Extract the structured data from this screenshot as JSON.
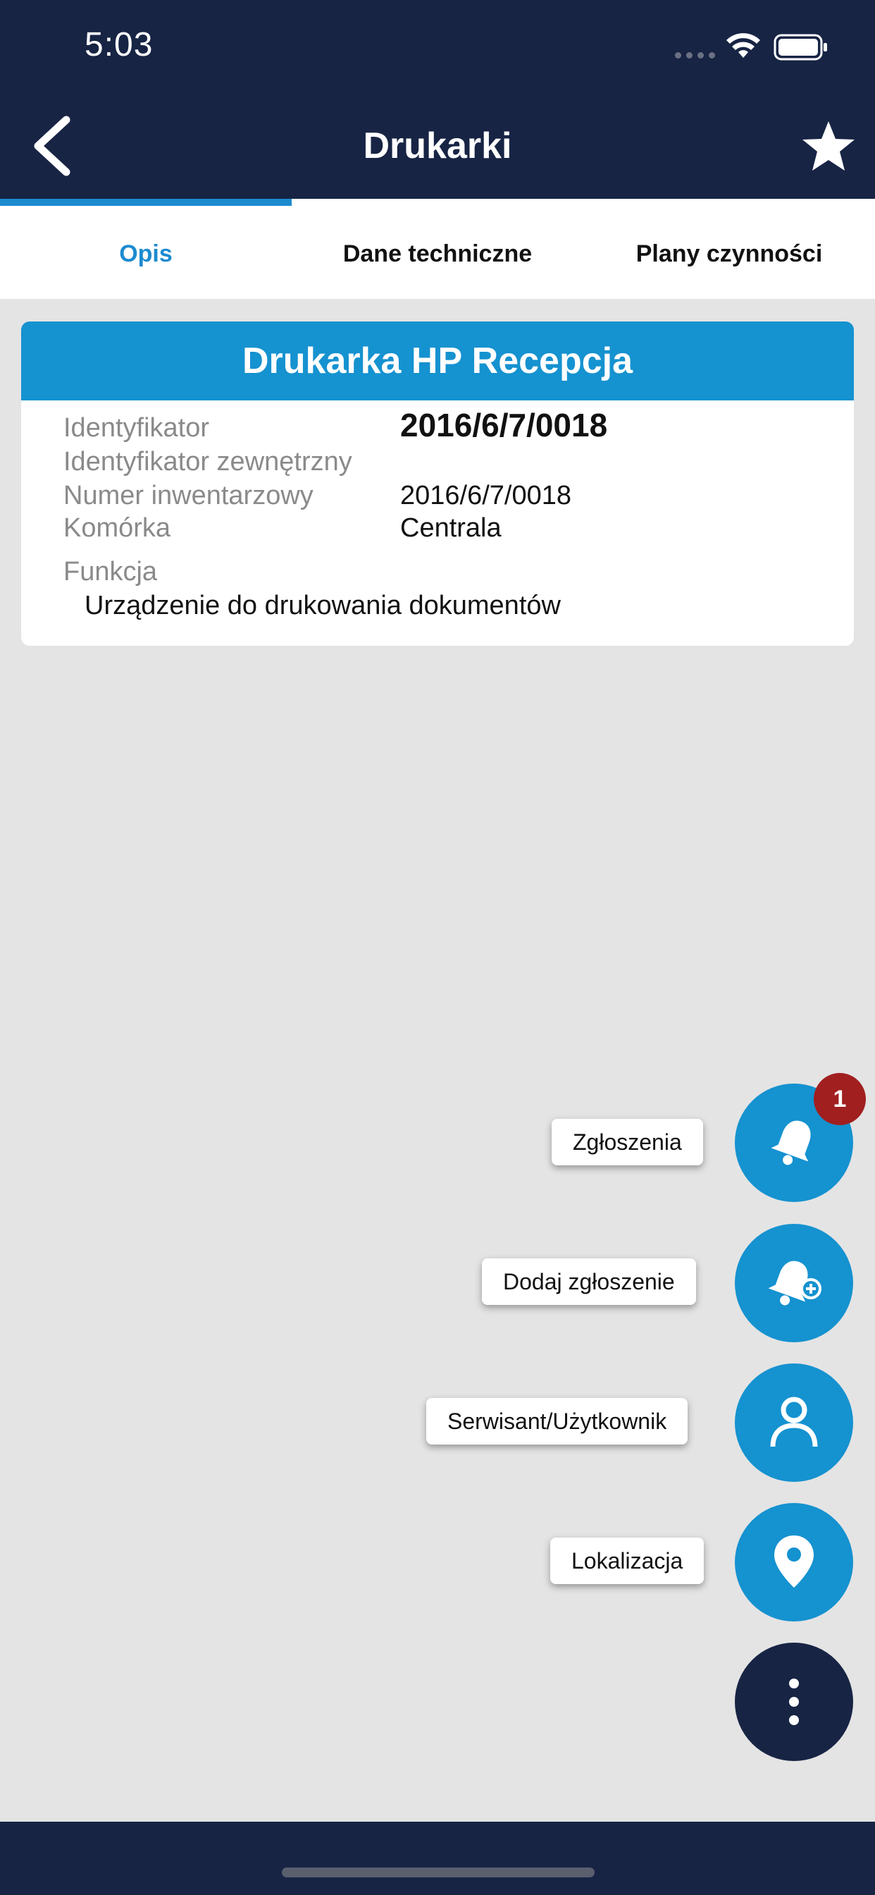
{
  "status_bar": {
    "time": "5:03"
  },
  "nav": {
    "title": "Drukarki",
    "back_icon": "chevron-left-icon",
    "favorite_icon": "star-icon"
  },
  "tabs": [
    {
      "label": "Opis",
      "active": true
    },
    {
      "label": "Dane techniczne",
      "active": false
    },
    {
      "label": "Plany czynności",
      "active": false
    }
  ],
  "card": {
    "title": "Drukarka HP Recepcja",
    "fields": [
      {
        "label": "Identyfikator",
        "value": "2016/6/7/0018"
      },
      {
        "label": "Identyfikator zewnętrzny",
        "value": ""
      },
      {
        "label": "Numer inwentarzowy",
        "value": "2016/6/7/0018"
      },
      {
        "label": "Komórka",
        "value": "Centrala"
      }
    ],
    "function_label": "Funkcja",
    "function_value": "Urządzenie do drukowania dokumentów"
  },
  "actions": [
    {
      "label": "Zgłoszenia",
      "icon": "bell-icon",
      "badge": "1"
    },
    {
      "label": "Dodaj zgłoszenie",
      "icon": "bell-plus-icon"
    },
    {
      "label": "Serwisant/Użytkownik",
      "icon": "user-icon"
    },
    {
      "label": "Lokalizacja",
      "icon": "location-pin-icon"
    }
  ],
  "menu_fab": {
    "icon": "more-vertical-icon"
  },
  "colors": {
    "header": "#172444",
    "accent": "#1592d0",
    "tab_active": "#1d8bd0",
    "badge": "#a11f1f",
    "background": "#e4e4e4"
  }
}
